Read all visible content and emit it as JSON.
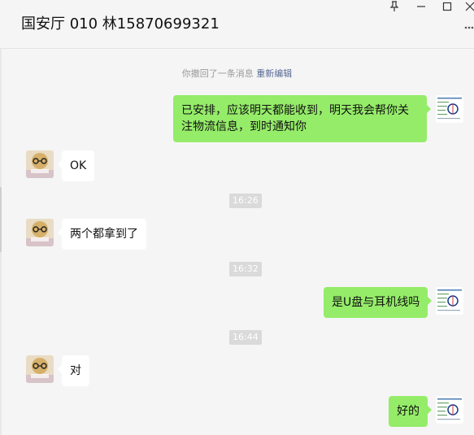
{
  "window": {
    "title": "国安厅 010  林15870699321",
    "controls": {
      "pin": "⚲",
      "minimize": "—",
      "maximize": "☐",
      "close": "✕"
    },
    "more_icon": "more-icon"
  },
  "system_notice": {
    "text": "你撤回了一条消息 ",
    "link": "重新编辑"
  },
  "messages": [
    {
      "side": "right",
      "text": "已安排，应该明天都能收到，明天我会帮你关注物流信息，到时通知你"
    },
    {
      "side": "left",
      "text": "OK"
    },
    {
      "type": "time",
      "text": "16:26"
    },
    {
      "side": "left",
      "text": "两个都拿到了"
    },
    {
      "type": "time",
      "text": "16:32"
    },
    {
      "side": "right",
      "text": "是U盘与耳机线吗"
    },
    {
      "type": "time",
      "text": "16:44"
    },
    {
      "side": "left",
      "text": "对"
    },
    {
      "side": "right",
      "text": "好的"
    }
  ],
  "colors": {
    "my_bubble": "#95ec69",
    "their_bubble": "#ffffff",
    "background": "#f5f5f5",
    "link": "#576b95"
  }
}
